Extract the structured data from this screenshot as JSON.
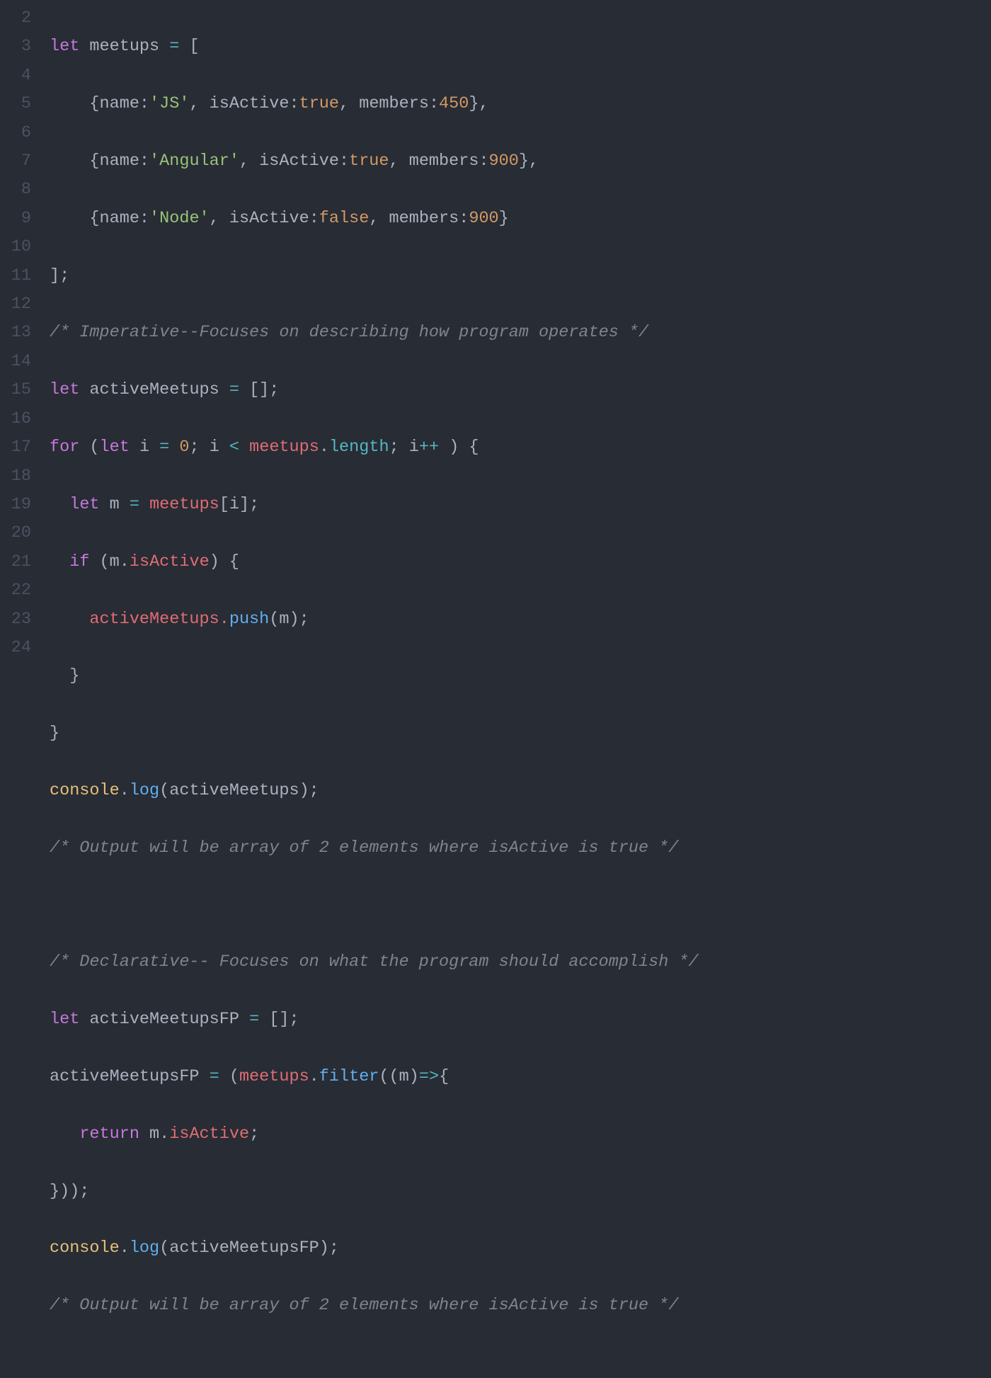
{
  "line_numbers": [
    "2",
    "3",
    "4",
    "5",
    "6",
    "7",
    "8",
    "9",
    "10",
    "11",
    "12",
    "13",
    "14",
    "15",
    "16",
    "17",
    "18",
    "19",
    "20",
    "21",
    "22",
    "23",
    "24"
  ],
  "lines": {
    "l2": {
      "t0": "let",
      "t1": " meetups ",
      "t2": "=",
      "t3": " ["
    },
    "l3": {
      "t0": "    {name",
      "t1": ":",
      "t2": "'JS'",
      "t3": ", isActive",
      "t4": ":",
      "t5": "true",
      "t6": ", members",
      "t7": ":",
      "t8": "450",
      "t9": "},"
    },
    "l4": {
      "t0": "    {name",
      "t1": ":",
      "t2": "'Angular'",
      "t3": ", isActive",
      "t4": ":",
      "t5": "true",
      "t6": ", members",
      "t7": ":",
      "t8": "900",
      "t9": "},"
    },
    "l5": {
      "t0": "    {name",
      "t1": ":",
      "t2": "'Node'",
      "t3": ", isActive",
      "t4": ":",
      "t5": "false",
      "t6": ", members",
      "t7": ":",
      "t8": "900",
      "t9": "}"
    },
    "l6": {
      "t0": "];"
    },
    "l7": {
      "t0": "/* Imperative--Focuses on describing how program operates */"
    },
    "l8": {
      "t0": "let",
      "t1": " activeMeetups ",
      "t2": "=",
      "t3": " [];"
    },
    "l9": {
      "t0": "for",
      "t1": " (",
      "t2": "let",
      "t3": " i ",
      "t4": "=",
      "t5": " ",
      "t6": "0",
      "t7": "; i ",
      "t8": "<",
      "t9": " ",
      "t10": "meetups",
      "t11": ".",
      "t12": "length",
      "t13": "; i",
      "t14": "++",
      "t15": " ) {"
    },
    "l10": {
      "t0": "  ",
      "t1": "let",
      "t2": " m ",
      "t3": "=",
      "t4": " ",
      "t5": "meetups",
      "t6": "[i];"
    },
    "l11": {
      "t0": "  ",
      "t1": "if",
      "t2": " (m.",
      "t3": "isActive",
      "t4": ") {"
    },
    "l12": {
      "t0": "    activeMeetups.",
      "t1": "push",
      "t2": "(m);"
    },
    "l13": {
      "t0": "  }"
    },
    "l14": {
      "t0": "}"
    },
    "l15": {
      "t0": "console",
      "t1": ".",
      "t2": "log",
      "t3": "(activeMeetups);"
    },
    "l16": {
      "t0": "/* Output will be array of 2 elements where isActive is true */"
    },
    "l17": {
      "t0": ""
    },
    "l18": {
      "t0": "/* Declarative-- Focuses on what the program should accomplish */"
    },
    "l19": {
      "t0": "let",
      "t1": " activeMeetupsFP ",
      "t2": "=",
      "t3": " [];"
    },
    "l20": {
      "t0": "activeMeetupsFP ",
      "t1": "=",
      "t2": " (",
      "t3": "meetups",
      "t4": ".",
      "t5": "filter",
      "t6": "((m)",
      "t7": "=>",
      "t8": "{"
    },
    "l21": {
      "t0": "   ",
      "t1": "return",
      "t2": " m.",
      "t3": "isActive",
      "t4": ";"
    },
    "l22": {
      "t0": "}));"
    },
    "l23": {
      "t0": "console",
      "t1": ".",
      "t2": "log",
      "t3": "(activeMeetupsFP);"
    },
    "l24": {
      "t0": "/* Output will be array of 2 elements where isActive is true */"
    }
  }
}
